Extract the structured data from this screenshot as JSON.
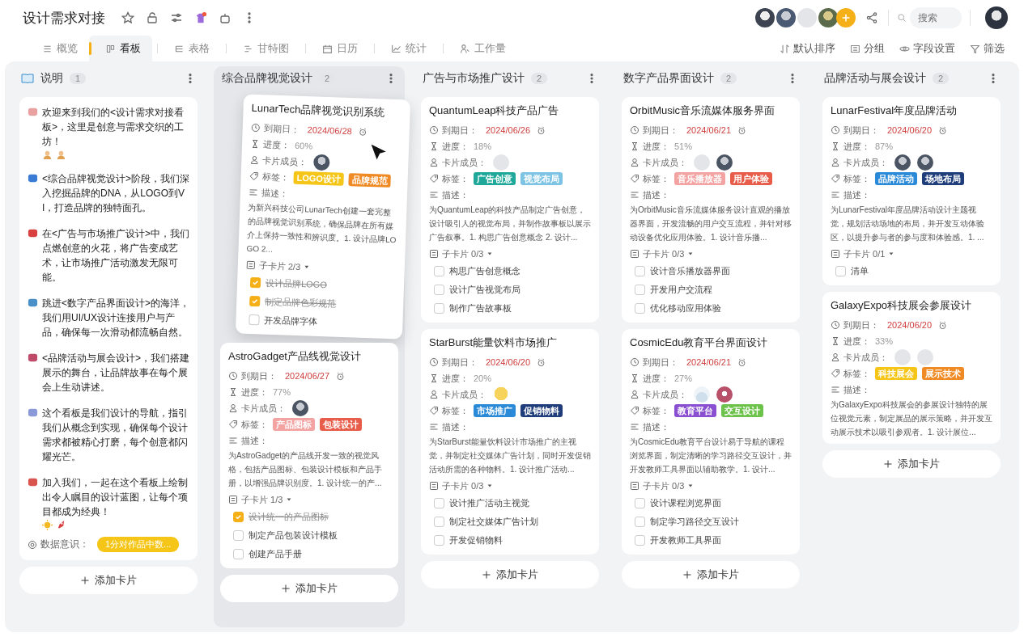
{
  "header": {
    "title": "设计需求对接",
    "search": {
      "placeholder": "搜索"
    }
  },
  "tabs": [
    {
      "label": "概览",
      "selected": false
    },
    {
      "label": "看板",
      "selected": true
    },
    {
      "label": "表格",
      "selected": false
    },
    {
      "label": "甘特图",
      "selected": false
    },
    {
      "label": "日历",
      "selected": false
    },
    {
      "label": "统计",
      "selected": false
    },
    {
      "label": "工作量",
      "selected": false
    }
  ],
  "actions": [
    "默认排序",
    "分组",
    "字段设置",
    "筛选"
  ],
  "columns": [
    {
      "title": "说明",
      "count": "1",
      "add_label": "添加卡片",
      "cards": [
        {
          "kind": "note",
          "dragging": false,
          "paragraphs": [
            "欢迎来到我们的<设计需求对接看板>，这里是创意与需求交织的工坊！",
            "<综合品牌视觉设计>阶段，我们深入挖掘品牌的DNA，从LOGO到VI，打造品牌的独特面孔。",
            "在<广告与市场推广设计>中，我们点燃创意的火花，将广告变成艺术，让市场推广活动激发无限可能。",
            "跳进<数字产品界面设计>的海洋，我们用UI/UX设计连接用户与产品，确保每一次滑动都流畅自然。",
            "<品牌活动与展会设计>，我们搭建展示的舞台，让品牌故事在每个展会上生动讲述。",
            "这个看板是我们设计的导航，指引我们从概念到实现，确保每个设计需求都被精心打磨，每个创意都闪耀光芒。",
            "加入我们，一起在这个看板上绘制出令人瞩目的设计蓝图，让每个项目都成为经典！"
          ],
          "field_label": "数据意识：",
          "field_tag": {
            "text": "1分对作品中数...",
            "color": "#f5c518"
          }
        }
      ]
    },
    {
      "title": "综合品牌视觉设计",
      "count": "2",
      "add_label": "添加卡片",
      "cards": [
        {
          "kind": "task",
          "dragging": true,
          "title": "LunarTech品牌视觉识别系统",
          "due_label": "到期日：",
          "due": "2024/06/28",
          "progress_label": "进度：",
          "progress": "60%",
          "members_label": "卡片成员：",
          "members": [
            {
              "kind": "photo"
            }
          ],
          "tags_label": "标签：",
          "tags": [
            {
              "text": "LOGO设计",
              "color": "#f5c518"
            },
            {
              "text": "品牌规范",
              "color": "#f08a24"
            }
          ],
          "desc_label": "描述：",
          "desc": "为新兴科技公司LunarTech创建一套完整的品牌视觉识别系统，确保品牌在所有媒介上保持一致性和辨识度。1. 设计品牌LOGO 2...",
          "subcards_label": "子卡片 2/3",
          "subtasks": [
            {
              "text": "设计品牌LOGO",
              "checked": true
            },
            {
              "text": "制定品牌色彩规范",
              "checked": true
            },
            {
              "text": "开发品牌字体",
              "checked": false
            }
          ]
        },
        {
          "kind": "task",
          "dragging": false,
          "title": "AstroGadget产品线视觉设计",
          "due_label": "到期日：",
          "due": "2024/06/27",
          "progress_label": "进度：",
          "progress": "77%",
          "members_label": "卡片成员：",
          "members": [
            {
              "kind": "photo"
            }
          ],
          "tags_label": "标签：",
          "tags": [
            {
              "text": "产品图标",
              "color": "#f4a3a3"
            },
            {
              "text": "包装设计",
              "color": "#e85c4a"
            }
          ],
          "desc_label": "描述：",
          "desc": "为AstroGadget的产品线开发一致的视觉风格，包括产品图标、包装设计模板和产品手册，以增强品牌识别度。1. 设计统一的产...",
          "subcards_label": "子卡片 1/3",
          "subtasks": [
            {
              "text": "设计统一的产品图标",
              "checked": true
            },
            {
              "text": "制定产品包装设计模板",
              "checked": false
            },
            {
              "text": "创建产品手册",
              "checked": false
            }
          ]
        }
      ]
    },
    {
      "title": "广告与市场推广设计",
      "count": "2",
      "add_label": "添加卡片",
      "cards": [
        {
          "kind": "task",
          "dragging": false,
          "title": "QuantumLeap科技产品广告",
          "due_label": "到期日：",
          "due": "2024/06/26",
          "progress_label": "进度：",
          "progress": "18%",
          "members_label": "卡片成员：",
          "members": [
            {
              "kind": "placeholder"
            }
          ],
          "tags_label": "标签：",
          "tags": [
            {
              "text": "广告创意",
              "color": "#1fa89a"
            },
            {
              "text": "视觉布局",
              "color": "#7dc4e4"
            }
          ],
          "desc_label": "描述：",
          "desc": "为QuantumLeap的科技产品制定广告创意，设计吸引人的视觉布局，并制作故事板以展示广告叙事。1. 构思广告创意概念 2. 设计...",
          "subcards_label": "子卡片 0/3",
          "subtasks": [
            {
              "text": "构思广告创意概念",
              "checked": false
            },
            {
              "text": "设计广告视觉布局",
              "checked": false
            },
            {
              "text": "制作广告故事板",
              "checked": false
            }
          ]
        },
        {
          "kind": "task",
          "dragging": false,
          "title": "StarBurst能量饮料市场推广",
          "due_label": "到期日：",
          "due": "2024/06/20",
          "progress_label": "进度：",
          "progress": "20%",
          "members_label": "卡片成员：",
          "members": [
            {
              "kind": "cartoon"
            }
          ],
          "tags_label": "标签：",
          "tags": [
            {
              "text": "市场推广",
              "color": "#2a8ad8"
            },
            {
              "text": "促销物料",
              "color": "#1f3d7a"
            }
          ],
          "desc_label": "描述：",
          "desc": "为StarBurst能量饮料设计市场推广的主视觉，并制定社交媒体广告计划，同时开发促销活动所需的各种物料。1. 设计推广活动...",
          "subcards_label": "子卡片 0/3",
          "subtasks": [
            {
              "text": "设计推广活动主视觉",
              "checked": false
            },
            {
              "text": "制定社交媒体广告计划",
              "checked": false
            },
            {
              "text": "开发促销物料",
              "checked": false
            }
          ]
        }
      ]
    },
    {
      "title": "数字产品界面设计",
      "count": "2",
      "add_label": "添加卡片",
      "cards": [
        {
          "kind": "task",
          "dragging": false,
          "title": "OrbitMusic音乐流媒体服务界面",
          "due_label": "到期日：",
          "due": "2024/06/21",
          "progress_label": "进度：",
          "progress": "51%",
          "members_label": "卡片成员：",
          "members": [
            {
              "kind": "placeholder"
            },
            {
              "kind": "photo"
            }
          ],
          "tags_label": "标签：",
          "tags": [
            {
              "text": "音乐播放器",
              "color": "#f4a3a3"
            },
            {
              "text": "用户体验",
              "color": "#e85c4a"
            }
          ],
          "desc_label": "描述：",
          "desc": "为OrbitMusic音乐流媒体服务设计直观的播放器界面，开发流畅的用户交互流程，并针对移动设备优化应用体验。1. 设计音乐播...",
          "subcards_label": "子卡片 0/3",
          "subtasks": [
            {
              "text": "设计音乐播放器界面",
              "checked": false
            },
            {
              "text": "开发用户交流程",
              "checked": false
            },
            {
              "text": "优化移动应用体验",
              "checked": false
            }
          ]
        },
        {
          "kind": "task",
          "dragging": false,
          "title": "CosmicEdu教育平台界面设计",
          "due_label": "到期日：",
          "due": "2024/06/21",
          "progress_label": "进度：",
          "progress": "27%",
          "members_label": "卡片成员：",
          "members": [
            {
              "kind": "light"
            },
            {
              "kind": "pink"
            }
          ],
          "tags_label": "标签：",
          "tags": [
            {
              "text": "教育平台",
              "color": "#8a4fd0"
            },
            {
              "text": "交互设计",
              "color": "#6cc24a"
            }
          ],
          "desc_label": "描述：",
          "desc": "为CosmicEdu教育平台设计易于导航的课程浏览界面，制定清晰的学习路径交互设计，并开发教师工具界面以辅助教学。1. 设计...",
          "subcards_label": "子卡片 0/3",
          "subtasks": [
            {
              "text": "设计课程浏览界面",
              "checked": false
            },
            {
              "text": "制定学习路径交互设计",
              "checked": false
            },
            {
              "text": "开发教师工具界面",
              "checked": false
            }
          ]
        }
      ]
    },
    {
      "title": "品牌活动与展会设计",
      "count": "2",
      "add_label": "添加卡片",
      "cards": [
        {
          "kind": "task",
          "dragging": false,
          "title": "LunarFestival年度品牌活动",
          "due_label": "到期日：",
          "due": "2024/06/20",
          "progress_label": "进度：",
          "progress": "87%",
          "members_label": "卡片成员：",
          "members": [
            {
              "kind": "photo"
            },
            {
              "kind": "photo"
            }
          ],
          "tags_label": "标签：",
          "tags": [
            {
              "text": "品牌活动",
              "color": "#2a8ad8"
            },
            {
              "text": "场地布局",
              "color": "#1f3d7a"
            }
          ],
          "desc_label": "描述：",
          "desc": "为LunarFestival年度品牌活动设计主题视觉，规划活动场地的布局，并开发互动体验区，以提升参与者的参与度和体验感。1. ...",
          "subcards_label": "子卡片 0/1",
          "subtasks": [
            {
              "text": "清单",
              "checked": false
            }
          ]
        },
        {
          "kind": "task",
          "dragging": false,
          "title": "GalaxyExpo科技展会参展设计",
          "due_label": "到期日：",
          "due": "2024/06/20",
          "progress_label": "进度：",
          "progress": "33%",
          "members_label": "卡片成员：",
          "members": [
            {
              "kind": "placeholder"
            },
            {
              "kind": "placeholder"
            }
          ],
          "tags_label": "标签：",
          "tags": [
            {
              "text": "科技展会",
              "color": "#f5c518"
            },
            {
              "text": "展示技术",
              "color": "#f08a24"
            }
          ],
          "desc_label": "描述：",
          "desc": "为GalaxyExpo科技展会的参展设计独特的展位视觉元素，制定展品的展示策略，并开发互动展示技术以吸引参观者。1. 设计展位..."
        }
      ]
    }
  ]
}
